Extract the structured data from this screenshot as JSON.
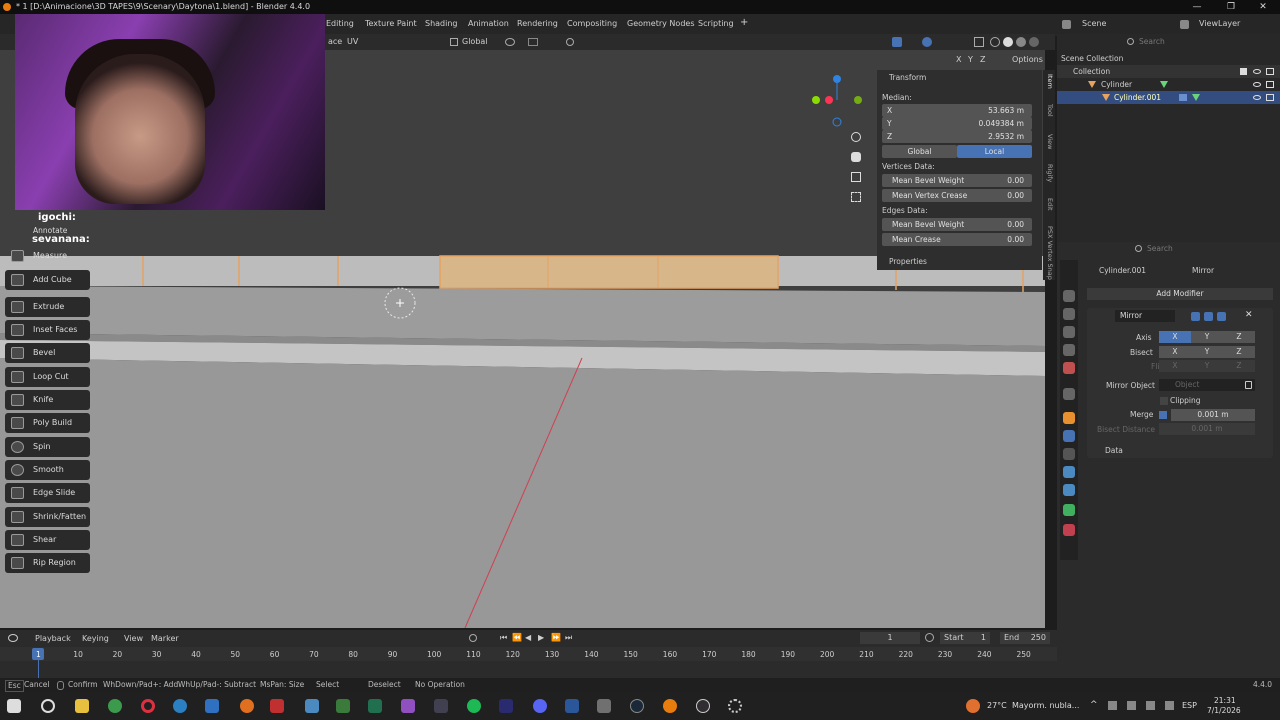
{
  "window": {
    "title": "* 1 [D:\\Animacione\\3D TAPES\\9\\Scenary\\Daytona\\1.blend] - Blender 4.4.0",
    "min": "—",
    "max": "❐",
    "close": "✕"
  },
  "workspaces": [
    "Editing",
    "Texture Paint",
    "Shading",
    "Animation",
    "Rendering",
    "Compositing",
    "Geometry Nodes",
    "Scripting"
  ],
  "add_workspace": "+",
  "scene": {
    "label": "Scene",
    "view_layer": "ViewLayer"
  },
  "viewport_header": {
    "face_label": "ace",
    "uv_label": "UV",
    "orientation": "Global",
    "options": "Options",
    "xyz": [
      "X",
      "Y",
      "Z"
    ]
  },
  "webcam_overlay": {
    "user1": "igochi:",
    "user2": "sevanana:",
    "annotate": "Annotate"
  },
  "toolbar": {
    "items": [
      "Measure",
      "Add Cube",
      "Extrude Region",
      "Inset Faces",
      "Bevel",
      "Loop Cut",
      "Knife",
      "Poly Build",
      "Spin",
      "Smooth",
      "Edge Slide",
      "Shrink/Fatten",
      "Shear",
      "Rip Region"
    ]
  },
  "npanel": {
    "transform": "Transform",
    "median": "Median:",
    "x_label": "X",
    "x_val": "53.663 m",
    "y_label": "Y",
    "y_val": "0.049384 m",
    "z_label": "Z",
    "z_val": "2.9532 m",
    "global": "Global",
    "local": "Local",
    "vertices_data": "Vertices Data:",
    "mean_bevel_weight": "Mean Bevel Weight",
    "mean_bevel_weight_v": "0.00",
    "mean_vertex_crease": "Mean Vertex Crease",
    "mean_vertex_crease_v": "0.00",
    "edges_data": "Edges Data:",
    "edge_bevel_weight": "Mean Bevel Weight",
    "edge_bevel_weight_v": "0.00",
    "mean_crease": "Mean Crease",
    "mean_crease_v": "0.00",
    "properties": "Properties"
  },
  "side_tabs": [
    "Item",
    "Tool",
    "View",
    "Rigify",
    "Edit",
    "PSX Vertex Snap"
  ],
  "outliner": {
    "search_placeholder": "Search",
    "scene_collection": "Scene Collection",
    "collection": "Collection",
    "obj1": "Cylinder",
    "obj2": "Cylinder.001"
  },
  "properties": {
    "search_placeholder": "Search",
    "object": "Cylinder.001",
    "modifier_crumb": "Mirror",
    "add_modifier": "Add Modifier",
    "modifier_name": "Mirror",
    "axis_label": "Axis",
    "bisect_label": "Bisect",
    "flip_label": "Flip",
    "x": "X",
    "y": "Y",
    "z": "Z",
    "mirror_object": "Mirror Object",
    "object_placeholder": "Object",
    "clipping": "Clipping",
    "merge": "Merge",
    "merge_val": "0.001 m",
    "bisect_distance": "Bisect Distance",
    "bisect_distance_val": "0.001 m",
    "data": "Data"
  },
  "timeline": {
    "playback": "Playback",
    "keying": "Keying",
    "view": "View",
    "marker": "Marker",
    "current_frame": "1",
    "start_label": "Start",
    "start": "1",
    "end_label": "End",
    "end": "250",
    "ruler": [
      "1",
      "10",
      "20",
      "30",
      "40",
      "50",
      "60",
      "70",
      "80",
      "90",
      "100",
      "110",
      "120",
      "130",
      "140",
      "150",
      "160",
      "170",
      "180",
      "190",
      "200",
      "210",
      "220",
      "230",
      "240",
      "250"
    ]
  },
  "status": {
    "esc": "Esc",
    "cancel": "Cancel",
    "confirm": "Confirm",
    "hint1": "WhDown/Pad+: Add",
    "hint2": "WhUp/Pad-: Subtract",
    "hint3": "MsPan: Size",
    "select": "Select",
    "deselect": "Deselect",
    "no_op": "No Operation",
    "version": "4.4.0"
  },
  "taskbar": {
    "weather": "27°C",
    "weather_desc": "Mayorm. nubla...",
    "lang": "ESP",
    "time": "21:31",
    "date": "7/1/2026"
  },
  "colors": {
    "accent": "#4772b3",
    "selection": "#e8a260",
    "axis_x": "#ff3352"
  }
}
